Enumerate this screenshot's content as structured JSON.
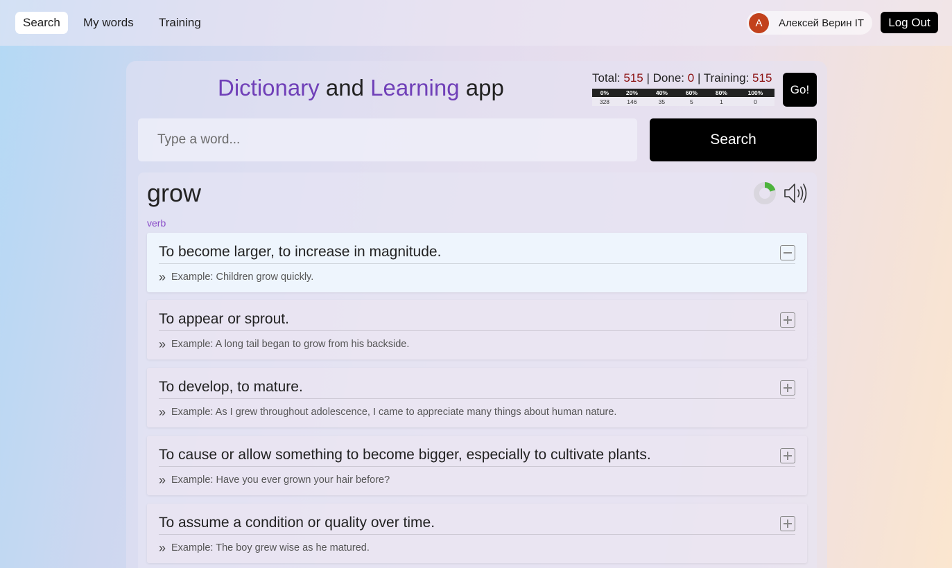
{
  "nav": {
    "tabs": [
      {
        "label": "Search",
        "active": true
      },
      {
        "label": "My words",
        "active": false
      },
      {
        "label": "Training",
        "active": false
      }
    ],
    "user": {
      "avatar_letter": "A",
      "name": "Алексей Верин IT",
      "avatar_color": "#c2411c"
    },
    "logout_label": "Log Out"
  },
  "header": {
    "title_parts": [
      "Dictionary",
      "and",
      "Learning",
      "app"
    ],
    "accent_color": "#7040b8",
    "stats": {
      "total_label": "Total:",
      "total": "515",
      "done_label": "Done:",
      "done": "0",
      "training_label": "Training:",
      "training": "515",
      "separator": "|"
    },
    "progress": {
      "headers": [
        "0%",
        "20%",
        "40%",
        "60%",
        "80%",
        "100%"
      ],
      "counts": [
        "328",
        "146",
        "35",
        "5",
        "1",
        "0"
      ]
    },
    "go_label": "Go!"
  },
  "search": {
    "placeholder": "Type a word...",
    "value": "",
    "button_label": "Search"
  },
  "result": {
    "word": "grow",
    "part_of_speech": "verb",
    "learning_progress": 0.2,
    "progress_color": "#4db33d",
    "definitions": [
      {
        "text": "To become larger, to increase in magnitude.",
        "example": "Example: Children grow quickly.",
        "expanded": true
      },
      {
        "text": "To appear or sprout.",
        "example": "Example: A long tail began to grow from his backside.",
        "expanded": false
      },
      {
        "text": "To develop, to mature.",
        "example": "Example: As I grew throughout adolescence, I came to appreciate many things about human nature.",
        "expanded": false
      },
      {
        "text": "To cause or allow something to become bigger, especially to cultivate plants.",
        "example": "Example: Have you ever grown your hair before?",
        "expanded": false
      },
      {
        "text": "To assume a condition or quality over time.",
        "example": "Example: The boy grew wise as he matured.",
        "expanded": false
      }
    ],
    "example_marker": "»"
  }
}
